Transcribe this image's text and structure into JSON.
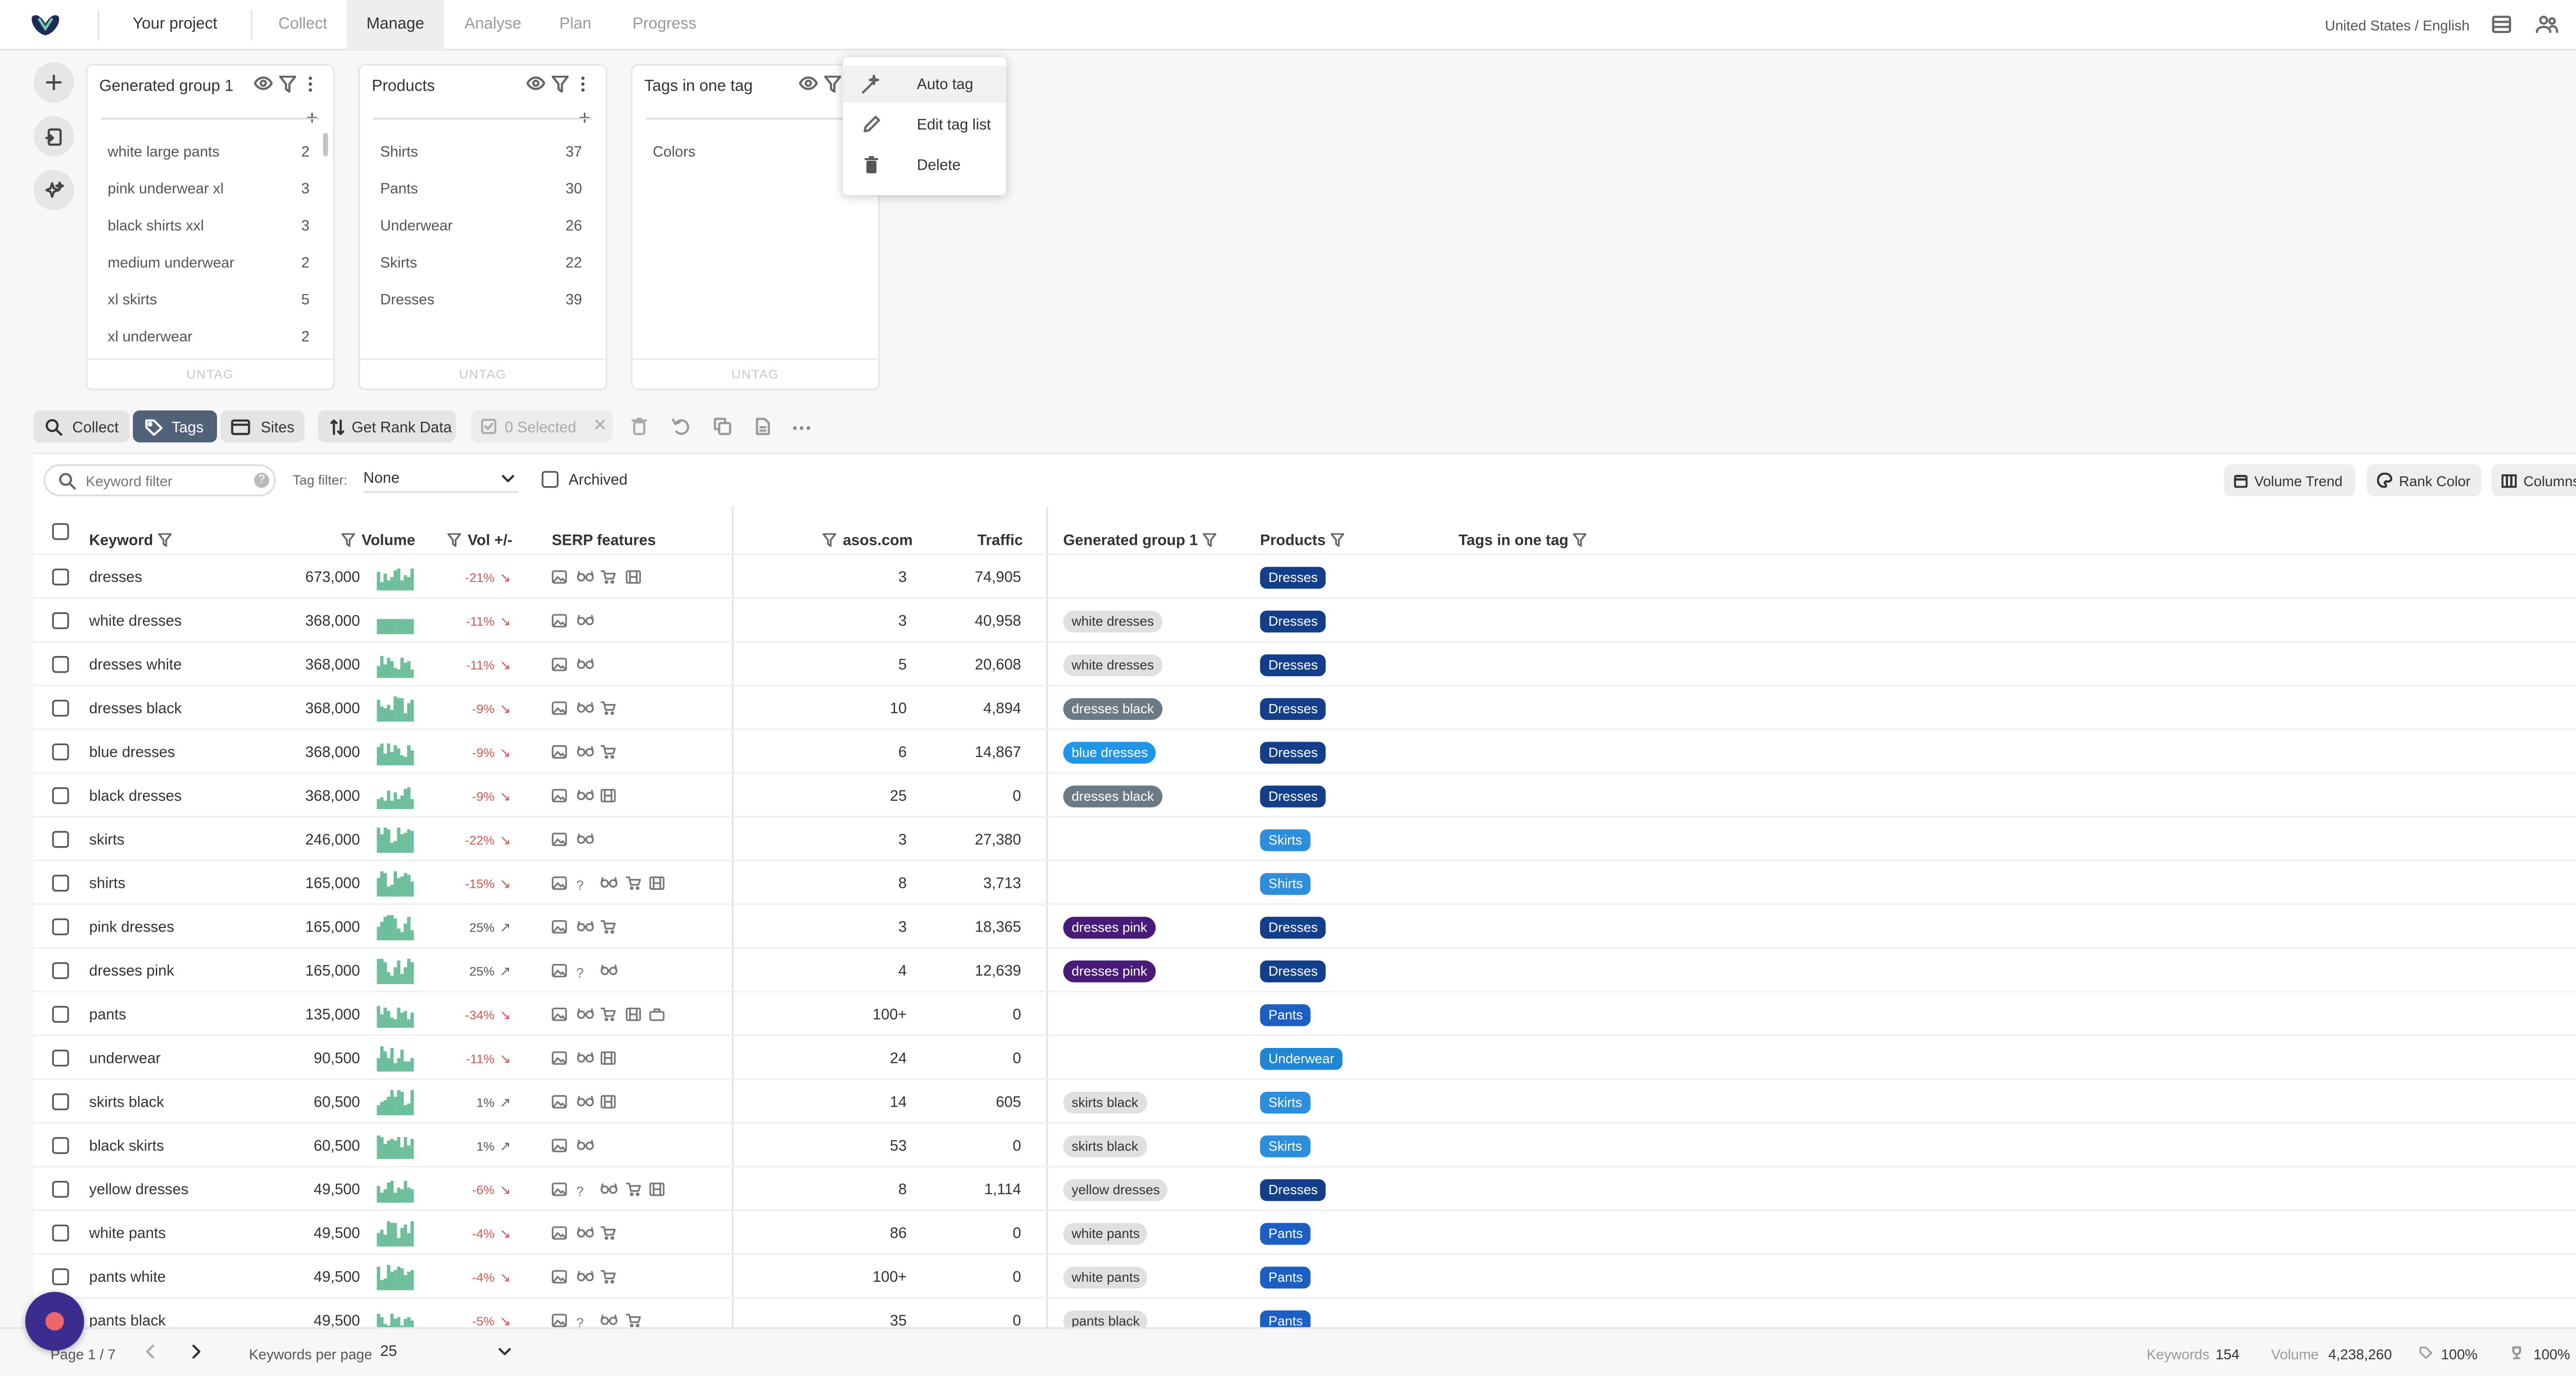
{
  "topbar": {
    "project": "Your project",
    "tabs": [
      "Collect",
      "Manage",
      "Analyse",
      "Plan",
      "Progress"
    ],
    "active_tab": "Manage",
    "locale": "United States / English"
  },
  "cards": [
    {
      "title": "Generated group 1",
      "items": [
        {
          "label": "white large pants",
          "count": "2"
        },
        {
          "label": "pink underwear xl",
          "count": "3"
        },
        {
          "label": "black shirts xxl",
          "count": "3"
        },
        {
          "label": "medium underwear",
          "count": "2"
        },
        {
          "label": "xl skirts",
          "count": "5"
        },
        {
          "label": "xl underwear",
          "count": "2"
        }
      ],
      "untag": "UNTAG"
    },
    {
      "title": "Products",
      "items": [
        {
          "label": "Shirts",
          "count": "37"
        },
        {
          "label": "Pants",
          "count": "30"
        },
        {
          "label": "Underwear",
          "count": "26"
        },
        {
          "label": "Skirts",
          "count": "22"
        },
        {
          "label": "Dresses",
          "count": "39"
        }
      ],
      "untag": "UNTAG"
    },
    {
      "title": "Tags in one tag",
      "items": [
        {
          "label": "Colors",
          "count": ""
        }
      ],
      "untag": "UNTAG"
    }
  ],
  "menu": {
    "items": [
      "Auto tag",
      "Edit tag list",
      "Delete"
    ]
  },
  "toolbar": {
    "collect": "Collect",
    "tags": "Tags",
    "sites": "Sites",
    "get_rank": "Get Rank Data",
    "selected": "0 Selected"
  },
  "filters": {
    "keyword_placeholder": "Keyword filter",
    "tag_filter_label": "Tag filter:",
    "tag_filter_value": "None",
    "archived": "Archived",
    "volume_trend": "Volume Trend",
    "rank_color": "Rank Color",
    "columns": "Columns"
  },
  "table": {
    "headers": {
      "keyword": "Keyword",
      "volume": "Volume",
      "vol_change": "Vol +/-",
      "serp": "SERP features",
      "site": "asos.com",
      "traffic": "Traffic",
      "group1": "Generated group 1",
      "products": "Products",
      "tags_one": "Tags in one tag"
    },
    "rows": [
      {
        "keyword": "dresses",
        "volume": "673,000",
        "change": "-21%",
        "dir": "down",
        "serp": [
          "img",
          "glasses",
          "cart",
          "film"
        ],
        "rank": "3",
        "traffic": "74,905",
        "group": "",
        "product": "Dresses"
      },
      {
        "keyword": "white dresses",
        "volume": "368,000",
        "change": "-11%",
        "dir": "down",
        "serp": [
          "img",
          "glasses"
        ],
        "rank": "3",
        "traffic": "40,958",
        "group": "white dresses",
        "product": "Dresses"
      },
      {
        "keyword": "dresses white",
        "volume": "368,000",
        "change": "-11%",
        "dir": "down",
        "serp": [
          "img",
          "glasses"
        ],
        "rank": "5",
        "traffic": "20,608",
        "group": "white dresses",
        "product": "Dresses"
      },
      {
        "keyword": "dresses black",
        "volume": "368,000",
        "change": "-9%",
        "dir": "down",
        "serp": [
          "img",
          "glasses",
          "cart"
        ],
        "rank": "10",
        "traffic": "4,894",
        "group": "dresses black",
        "product": "Dresses"
      },
      {
        "keyword": "blue dresses",
        "volume": "368,000",
        "change": "-9%",
        "dir": "down",
        "serp": [
          "img",
          "glasses",
          "cart"
        ],
        "rank": "6",
        "traffic": "14,867",
        "group": "blue dresses",
        "product": "Dresses"
      },
      {
        "keyword": "black dresses",
        "volume": "368,000",
        "change": "-9%",
        "dir": "down",
        "serp": [
          "img",
          "glasses",
          "film"
        ],
        "rank": "25",
        "traffic": "0",
        "group": "dresses black",
        "product": "Dresses"
      },
      {
        "keyword": "skirts",
        "volume": "246,000",
        "change": "-22%",
        "dir": "down",
        "serp": [
          "img",
          "glasses"
        ],
        "rank": "3",
        "traffic": "27,380",
        "group": "",
        "product": "Skirts"
      },
      {
        "keyword": "shirts",
        "volume": "165,000",
        "change": "-15%",
        "dir": "down",
        "serp": [
          "img",
          "question",
          "glasses",
          "cart",
          "film"
        ],
        "rank": "8",
        "traffic": "3,713",
        "group": "",
        "product": "Shirts"
      },
      {
        "keyword": "pink dresses",
        "volume": "165,000",
        "change": "25%",
        "dir": "up",
        "serp": [
          "img",
          "glasses",
          "cart"
        ],
        "rank": "3",
        "traffic": "18,365",
        "group": "dresses pink",
        "product": "Dresses"
      },
      {
        "keyword": "dresses pink",
        "volume": "165,000",
        "change": "25%",
        "dir": "up",
        "serp": [
          "img",
          "question",
          "glasses"
        ],
        "rank": "4",
        "traffic": "12,639",
        "group": "dresses pink",
        "product": "Dresses"
      },
      {
        "keyword": "pants",
        "volume": "135,000",
        "change": "-34%",
        "dir": "down",
        "serp": [
          "img",
          "glasses",
          "cart",
          "film",
          "bag"
        ],
        "rank": "100+",
        "traffic": "0",
        "group": "",
        "product": "Pants"
      },
      {
        "keyword": "underwear",
        "volume": "90,500",
        "change": "-11%",
        "dir": "down",
        "serp": [
          "img",
          "glasses",
          "film"
        ],
        "rank": "24",
        "traffic": "0",
        "group": "",
        "product": "Underwear"
      },
      {
        "keyword": "skirts black",
        "volume": "60,500",
        "change": "1%",
        "dir": "up",
        "serp": [
          "img",
          "glasses",
          "film"
        ],
        "rank": "14",
        "traffic": "605",
        "group": "skirts black",
        "product": "Skirts"
      },
      {
        "keyword": "black skirts",
        "volume": "60,500",
        "change": "1%",
        "dir": "up",
        "serp": [
          "img",
          "glasses"
        ],
        "rank": "53",
        "traffic": "0",
        "group": "skirts black",
        "product": "Skirts"
      },
      {
        "keyword": "yellow dresses",
        "volume": "49,500",
        "change": "-6%",
        "dir": "down",
        "serp": [
          "img",
          "question",
          "glasses",
          "cart",
          "film"
        ],
        "rank": "8",
        "traffic": "1,114",
        "group": "yellow dresses",
        "product": "Dresses"
      },
      {
        "keyword": "white pants",
        "volume": "49,500",
        "change": "-4%",
        "dir": "down",
        "serp": [
          "img",
          "glasses",
          "cart"
        ],
        "rank": "86",
        "traffic": "0",
        "group": "white pants",
        "product": "Pants"
      },
      {
        "keyword": "pants white",
        "volume": "49,500",
        "change": "-4%",
        "dir": "down",
        "serp": [
          "img",
          "glasses",
          "cart"
        ],
        "rank": "100+",
        "traffic": "0",
        "group": "white pants",
        "product": "Pants"
      },
      {
        "keyword": "pants black",
        "volume": "49,500",
        "change": "-5%",
        "dir": "down",
        "serp": [
          "img",
          "question",
          "glasses",
          "cart"
        ],
        "rank": "35",
        "traffic": "0",
        "group": "pants black",
        "product": "Pants"
      }
    ]
  },
  "colors": {
    "Dresses": "#123e8a",
    "Skirts": "#2d8fdc",
    "Shirts": "#2d8fdc",
    "Pants": "#1b5fc4",
    "Underwear": "#1f86d6",
    "white dresses": "#e0e0e0",
    "dresses black": "#6b7b86",
    "blue dresses": "#2196e8",
    "dresses pink": "#4a1a78",
    "skirts black": "#e0e0e0",
    "yellow dresses": "#e0e0e0",
    "white pants": "#e0e0e0",
    "pants black": "#e0e0e0"
  },
  "footer": {
    "page": "Page 1 / 7",
    "per_page_label": "Keywords per page",
    "per_page": "25",
    "keywords_label": "Keywords",
    "keywords": "154",
    "volume_label": "Volume",
    "volume": "4,238,260",
    "pct1": "100%",
    "pct2": "100%"
  }
}
